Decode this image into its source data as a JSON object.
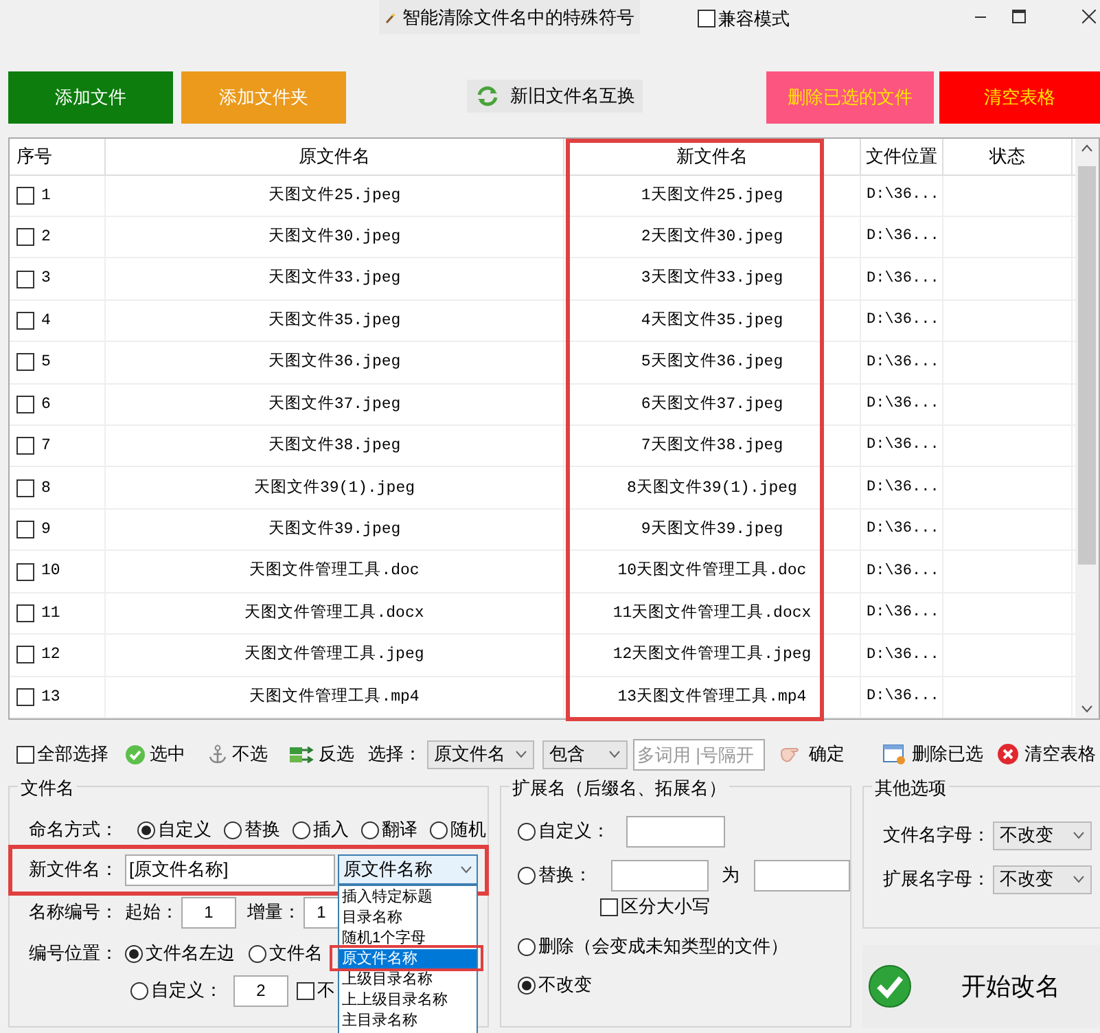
{
  "window": {
    "title": "智能清除文件名中的特殊符号"
  },
  "compat_mode": {
    "label": "兼容模式",
    "checked": false
  },
  "top_buttons": [
    {
      "label": "添加文件",
      "kind": "add-file"
    },
    {
      "label": "添加文件夹",
      "kind": "add-folder"
    },
    {
      "label": "新旧文件名互换",
      "kind": "swap"
    },
    {
      "label": "删除已选的文件",
      "kind": "delete"
    },
    {
      "label": "清空表格",
      "kind": "clear"
    }
  ],
  "table": {
    "columns": [
      "序号",
      "原文件名",
      "新文件名",
      "文件位置",
      "状态"
    ],
    "rows": [
      {
        "checked": false,
        "index": "1",
        "original": "天图文件25.jpeg",
        "new": "1天图文件25.jpeg",
        "location": "D:\\36..."
      },
      {
        "checked": false,
        "index": "2",
        "original": "天图文件30.jpeg",
        "new": "2天图文件30.jpeg",
        "location": "D:\\36..."
      },
      {
        "checked": false,
        "index": "3",
        "original": "天图文件33.jpeg",
        "new": "3天图文件33.jpeg",
        "location": "D:\\36..."
      },
      {
        "checked": false,
        "index": "4",
        "original": "天图文件35.jpeg",
        "new": "4天图文件35.jpeg",
        "location": "D:\\36..."
      },
      {
        "checked": false,
        "index": "5",
        "original": "天图文件36.jpeg",
        "new": "5天图文件36.jpeg",
        "location": "D:\\36..."
      },
      {
        "checked": false,
        "index": "6",
        "original": "天图文件37.jpeg",
        "new": "6天图文件37.jpeg",
        "location": "D:\\36..."
      },
      {
        "checked": false,
        "index": "7",
        "original": "天图文件38.jpeg",
        "new": "7天图文件38.jpeg",
        "location": "D:\\36..."
      },
      {
        "checked": false,
        "index": "8",
        "original": "天图文件39(1).jpeg",
        "new": "8天图文件39(1).jpeg",
        "location": "D:\\36..."
      },
      {
        "checked": false,
        "index": "9",
        "original": "天图文件39.jpeg",
        "new": "9天图文件39.jpeg",
        "location": "D:\\36..."
      },
      {
        "checked": false,
        "index": "10",
        "original": "天图文件管理工具.doc",
        "new": "10天图文件管理工具.doc",
        "location": "D:\\36..."
      },
      {
        "checked": false,
        "index": "11",
        "original": "天图文件管理工具.docx",
        "new": "11天图文件管理工具.docx",
        "location": "D:\\36..."
      },
      {
        "checked": false,
        "index": "12",
        "original": "天图文件管理工具.jpeg",
        "new": "12天图文件管理工具.jpeg",
        "location": "D:\\36..."
      },
      {
        "checked": false,
        "index": "13",
        "original": "天图文件管理工具.mp4",
        "new": "13天图文件管理工具.mp4",
        "location": "D:\\36..."
      }
    ]
  },
  "toolbar": {
    "select_all": {
      "label": "全部选择",
      "checked": false
    },
    "buttons": [
      {
        "label": "选中",
        "kind": "check"
      },
      {
        "label": "不选",
        "kind": "anchor"
      },
      {
        "label": "反选",
        "kind": "shuffle"
      }
    ],
    "filter_label": "选择：",
    "filter_field": "原文件名",
    "filter_mode": "包含",
    "keyword_placeholder": "多词用 |号隔开",
    "confirm": "确定",
    "delete_selected": "删除已选",
    "clear_table": "清空表格"
  },
  "filename": {
    "title": "文件名",
    "mode_label": "命名方式：",
    "modes": [
      {
        "label": "自定义",
        "selected": true
      },
      {
        "label": "替换",
        "selected": false
      },
      {
        "label": "插入",
        "selected": false
      },
      {
        "label": "翻译",
        "selected": false
      },
      {
        "label": "随机",
        "selected": false
      }
    ],
    "new_name_label": "新文件名：",
    "new_name_value": "[原文件名称]",
    "insert_select": "原文件名称",
    "insert_options": [
      {
        "label": "插入特定标题",
        "selected": false
      },
      {
        "label": "目录名称",
        "selected": false
      },
      {
        "label": "随机1个字母",
        "selected": false
      },
      {
        "label": "原文件名称",
        "selected": true
      },
      {
        "label": "上级目录名称",
        "selected": false
      },
      {
        "label": "上上级目录名称",
        "selected": false
      },
      {
        "label": "主目录名称",
        "selected": false
      }
    ],
    "numbering_label": "名称编号：",
    "start_label": "起始：",
    "start": "1",
    "step_label": "增量：",
    "step": "1",
    "position_label": "编号位置：",
    "positions": [
      {
        "label": "文件名左边",
        "selected": true
      },
      {
        "label": "文件名",
        "selected": false
      }
    ],
    "custom_position": {
      "label": "自定义：",
      "selected": false,
      "value": "2"
    },
    "extra_checkbox": {
      "label": "不",
      "checked": false
    }
  },
  "extension": {
    "title": "扩展名（后缀名、拓展名）",
    "custom": {
      "label": "自定义：",
      "selected": false
    },
    "replace": {
      "label": "替换：",
      "selected": false,
      "joiner": "为"
    },
    "case_sensitive": {
      "label": "区分大小写",
      "checked": false
    },
    "delete": {
      "label": "删除（会变成未知类型的文件）",
      "selected": false
    },
    "keep": {
      "label": "不改变",
      "selected": true
    }
  },
  "other": {
    "title": "其他选项",
    "fields": [
      {
        "label": "文件名字母：",
        "value": "不改变"
      },
      {
        "label": "扩展名字母：",
        "value": "不改变"
      }
    ]
  },
  "start_button": "开始改名"
}
